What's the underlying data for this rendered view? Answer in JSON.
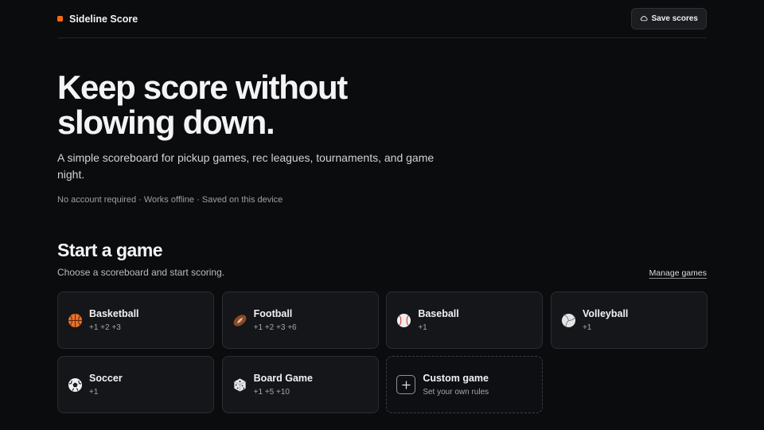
{
  "header": {
    "brand_name": "Sideline Score",
    "save_label": "Save scores"
  },
  "hero": {
    "title_line1": "Keep score without",
    "title_line2": "slowing down.",
    "subtitle": "A simple scoreboard for pickup games, rec leagues, tournaments, and game night.",
    "meta": "No account required · Works offline · Saved on this device"
  },
  "games_section": {
    "title": "Start a game",
    "subtitle": "Choose a scoreboard and start scoring.",
    "manage_label": "Manage games",
    "games": [
      {
        "name": "Basketball",
        "points": "+1 +2 +3",
        "icon": "basketball-icon"
      },
      {
        "name": "Football",
        "points": "+1 +2 +3 +6",
        "icon": "football-icon"
      },
      {
        "name": "Baseball",
        "points": "+1",
        "icon": "baseball-icon"
      },
      {
        "name": "Volleyball",
        "points": "+1",
        "icon": "volleyball-icon"
      },
      {
        "name": "Soccer",
        "points": "+1",
        "icon": "soccer-ball-icon"
      },
      {
        "name": "Board Game",
        "points": "+1 +5 +10",
        "icon": "dice-icon"
      }
    ],
    "custom": {
      "name": "Custom game",
      "description": "Set your own rules",
      "icon": "plus-icon"
    }
  },
  "colors": {
    "background": "#0b0c0e",
    "card": "#141619",
    "accent": "#f06a14",
    "text": "#f4f4f5",
    "muted": "#a4a6ab"
  }
}
